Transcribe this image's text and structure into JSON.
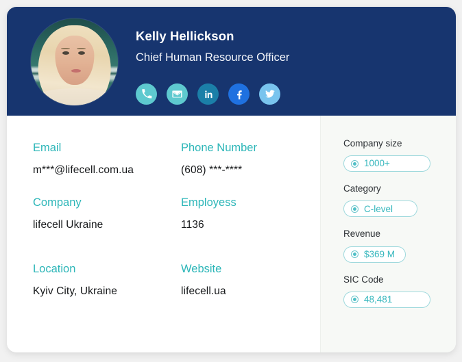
{
  "profile": {
    "name": "Kelly Hellickson",
    "title": "Chief Human Resource Officer",
    "avatar_alt": "portrait-photo"
  },
  "social": {
    "items": [
      {
        "icon": "phone-icon",
        "name": "phone",
        "color": "#5ec9cf"
      },
      {
        "icon": "email-icon",
        "name": "email",
        "color": "#5ec9cf"
      },
      {
        "icon": "linkedin-icon",
        "name": "linkedin",
        "color": "#1b7fa8"
      },
      {
        "icon": "facebook-icon",
        "name": "facebook",
        "color": "#1f71e0"
      },
      {
        "icon": "twitter-icon",
        "name": "twitter",
        "color": "#79c4ee"
      }
    ]
  },
  "details": {
    "email": {
      "label": "Email",
      "value": "m***@lifecell.com.ua"
    },
    "phone": {
      "label": "Phone Number",
      "value": "(608) ***-****"
    },
    "company": {
      "label": "Company",
      "value": "lifecell Ukraine"
    },
    "employees": {
      "label": "Employess",
      "value": "1136"
    },
    "location": {
      "label": "Location",
      "value": "Kyiv City, Ukraine"
    },
    "website": {
      "label": "Website",
      "value": "lifecell.ua"
    }
  },
  "sidebar": {
    "company_size": {
      "label": "Company size",
      "value": "1000+"
    },
    "category": {
      "label": "Category",
      "value": "C-level"
    },
    "revenue": {
      "label": "Revenue",
      "value": "$369 M"
    },
    "sic_code": {
      "label": "SIC Code",
      "value": "48,481"
    }
  },
  "colors": {
    "header_navy": "#17356f",
    "label_teal": "#2cb6b8",
    "pill_teal": "#36b7bd",
    "pill_border": "#9fd9dd",
    "page_bg": "#f1f1f1",
    "sidebar_bg": "#f7f9f6"
  }
}
